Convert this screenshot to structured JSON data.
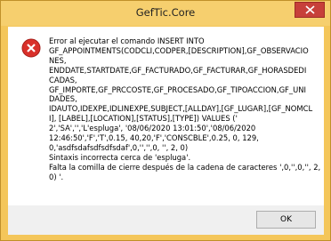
{
  "window": {
    "title": "GefTic.Core"
  },
  "message": {
    "lines": [
      "Error al ejecutar el comando INSERT INTO",
      "GF_APPOINTMENTS(CODCLI,CODPER,[DESCRIPTION],GF_OBSERVACIO",
      "NES,",
      "ENDDATE,STARTDATE,GF_FACTURADO,GF_FACTURAR,GF_HORASDEDI",
      "CADAS,",
      "GF_IMPORTE,GF_PRCCOSTE,GF_PROCESADO,GF_TIPOACCION,GF_UNI",
      "DADES,",
      "IDAUTO,IDEXPE,IDLINEXPE,SUBJECT,[ALLDAY],[GF_LUGAR],[GF_NOMCL",
      "I], [LABEL],[LOCATION],[STATUS],[TYPE]) VALUES ('",
      "2','SA','','L'espluga', '08/06/2020 13:01:50','08/06/2020",
      "12:46:50','F','T',0.15, 40,20,'F','CONSCBLE',0.25, 0, 129,",
      "0,'asdfsdafsdfsdfsdaf',0,'','',0, '', 2, 0)",
      "Sintaxis incorrecta cerca de 'espluga'.",
      "Falta la comilla de cierre después de la cadena de caracteres ',0,'',0,'', 2,",
      "0) '."
    ]
  },
  "buttons": {
    "ok_label": "OK"
  },
  "colors": {
    "titlebar": "#f6cf6e",
    "close_button": "#c7403a",
    "error_icon": "#d9302a"
  },
  "icons": {
    "error": "error-icon",
    "close": "close-icon"
  }
}
